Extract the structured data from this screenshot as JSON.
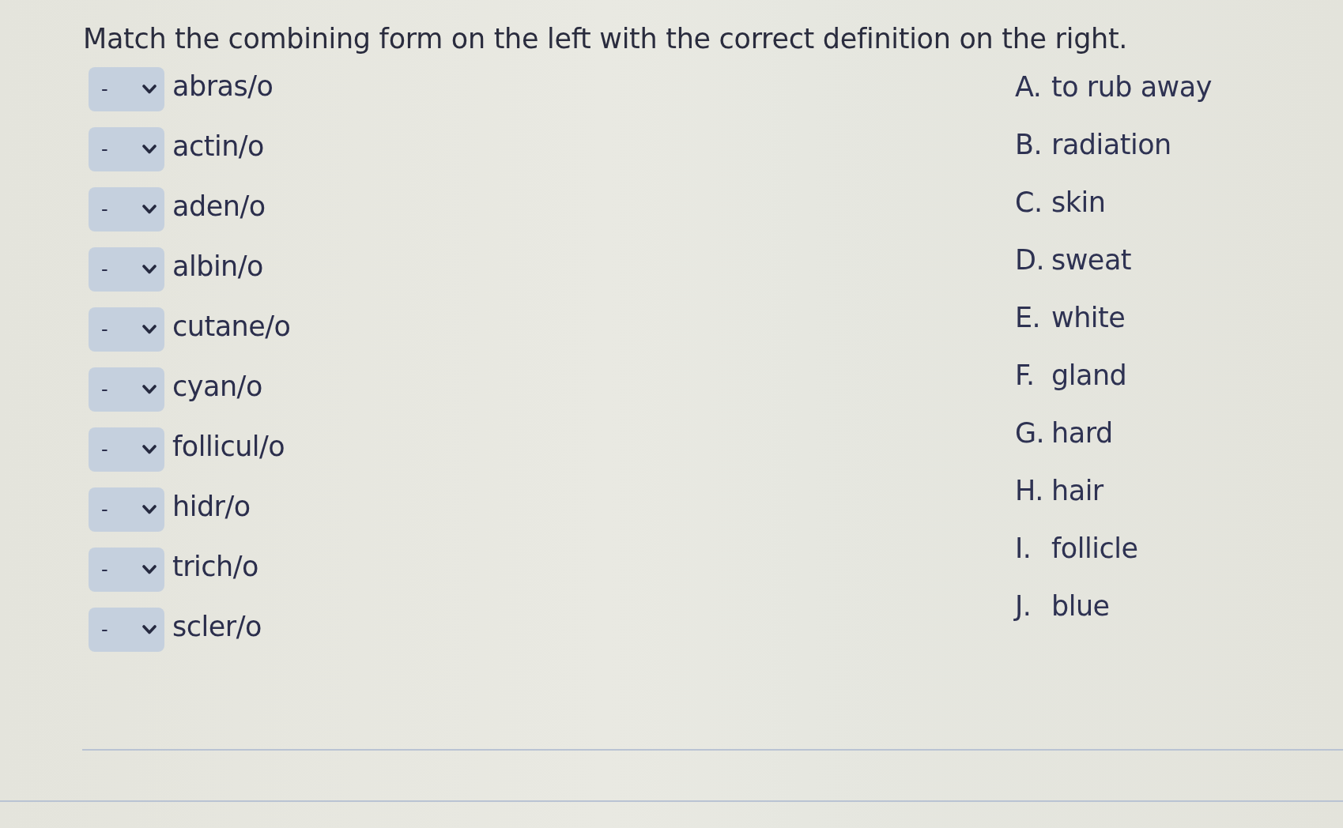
{
  "instruction": "Match the combining form on the left with the correct definition on the right.",
  "matches": [
    {
      "answer": "-",
      "term": "abras/o"
    },
    {
      "answer": "-",
      "term": "actin/o"
    },
    {
      "answer": "-",
      "term": "aden/o"
    },
    {
      "answer": "-",
      "term": "albin/o"
    },
    {
      "answer": "-",
      "term": "cutane/o"
    },
    {
      "answer": "-",
      "term": "cyan/o"
    },
    {
      "answer": "-",
      "term": "follicul/o"
    },
    {
      "answer": "-",
      "term": "hidr/o"
    },
    {
      "answer": "-",
      "term": "trich/o"
    },
    {
      "answer": "-",
      "term": "scler/o"
    }
  ],
  "definitions": [
    {
      "letter": "A.",
      "text": "to rub away"
    },
    {
      "letter": "B.",
      "text": "radiation"
    },
    {
      "letter": "C.",
      "text": "skin"
    },
    {
      "letter": "D.",
      "text": "sweat"
    },
    {
      "letter": "E.",
      "text": "white"
    },
    {
      "letter": "F.",
      "text": "gland"
    },
    {
      "letter": "G.",
      "text": "hard"
    },
    {
      "letter": "H.",
      "text": "hair"
    },
    {
      "letter": "I.",
      "text": "follicle"
    },
    {
      "letter": "J.",
      "text": "blue"
    }
  ]
}
